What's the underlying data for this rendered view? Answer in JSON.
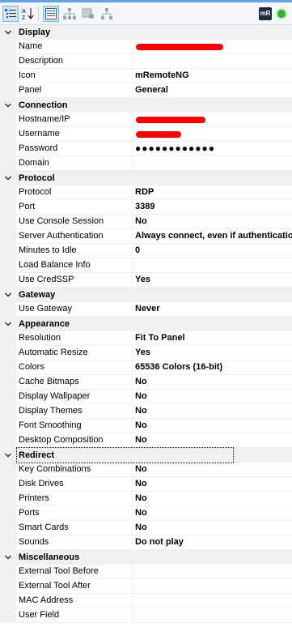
{
  "toolbar": {
    "buttons": [
      {
        "name": "categorized-view-icon",
        "active": true
      },
      {
        "name": "alphabetical-sort-icon",
        "active": false
      },
      {
        "name": "property-pages-icon",
        "active": true
      },
      {
        "name": "show-inheritance-icon",
        "active": false
      },
      {
        "name": "show-default-icon",
        "active": false
      },
      {
        "name": "show-hostname-icon",
        "active": false
      }
    ],
    "icon_label": "mR"
  },
  "categories": [
    {
      "label": "Display",
      "properties": [
        {
          "name": "Name",
          "value": "",
          "redacted": true
        },
        {
          "name": "Description",
          "value": ""
        },
        {
          "name": "Icon",
          "value": "mRemoteNG"
        },
        {
          "name": "Panel",
          "value": "General"
        }
      ]
    },
    {
      "label": "Connection",
      "properties": [
        {
          "name": "Hostname/IP",
          "value": "",
          "redacted": true
        },
        {
          "name": "Username",
          "value": "",
          "redacted": true
        },
        {
          "name": "Password",
          "value": "●●●●●●●●●●●●"
        },
        {
          "name": "Domain",
          "value": ""
        }
      ]
    },
    {
      "label": "Protocol",
      "properties": [
        {
          "name": "Protocol",
          "value": "RDP"
        },
        {
          "name": "Port",
          "value": "3389"
        },
        {
          "name": "Use Console Session",
          "value": "No"
        },
        {
          "name": "Server Authentication",
          "value": "Always connect, even if authentication"
        },
        {
          "name": "Minutes to Idle",
          "value": "0"
        },
        {
          "name": "Load Balance Info",
          "value": ""
        },
        {
          "name": "Use CredSSP",
          "value": "Yes"
        }
      ]
    },
    {
      "label": "Gateway",
      "properties": [
        {
          "name": "Use Gateway",
          "value": "Never"
        }
      ]
    },
    {
      "label": "Appearance",
      "properties": [
        {
          "name": "Resolution",
          "value": "Fit To Panel"
        },
        {
          "name": "Automatic Resize",
          "value": "Yes"
        },
        {
          "name": "Colors",
          "value": "65536 Colors (16-bit)"
        },
        {
          "name": "Cache Bitmaps",
          "value": "No"
        },
        {
          "name": "Display Wallpaper",
          "value": "No"
        },
        {
          "name": "Display Themes",
          "value": "No"
        },
        {
          "name": "Font Smoothing",
          "value": "No"
        },
        {
          "name": "Desktop Composition",
          "value": "No"
        }
      ]
    },
    {
      "label": "Redirect",
      "focused": true,
      "properties": [
        {
          "name": "Key Combinations",
          "value": "No"
        },
        {
          "name": "Disk Drives",
          "value": "No"
        },
        {
          "name": "Printers",
          "value": "No"
        },
        {
          "name": "Ports",
          "value": "No"
        },
        {
          "name": "Smart Cards",
          "value": "No"
        },
        {
          "name": "Sounds",
          "value": "Do not play"
        }
      ]
    },
    {
      "label": "Miscellaneous",
      "properties": [
        {
          "name": "External Tool Before",
          "value": ""
        },
        {
          "name": "External Tool After",
          "value": ""
        },
        {
          "name": "MAC Address",
          "value": ""
        },
        {
          "name": "User Field",
          "value": ""
        }
      ]
    }
  ],
  "colors": {
    "category_bg": "#f0f0f0",
    "redaction": "#ff0000",
    "status_green": "#2fb52f"
  }
}
